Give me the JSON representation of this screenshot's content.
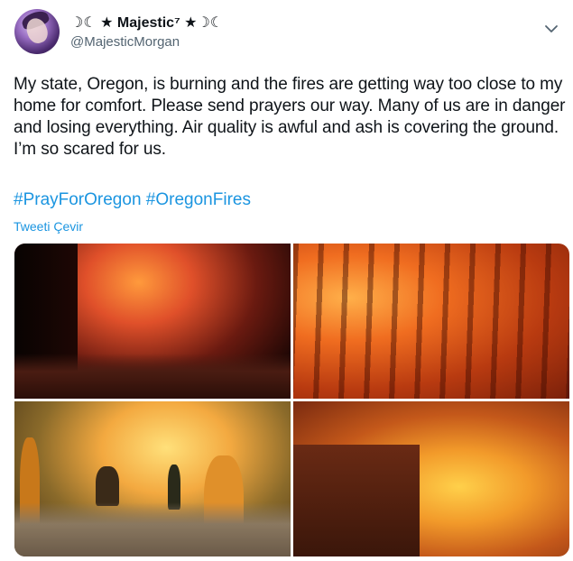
{
  "author": {
    "display_name": "☽☾ ★ Majestic⁷ ★☽☾",
    "handle": "@MajesticMorgan"
  },
  "tweet": {
    "text": "My state, Oregon, is burning and the fires are getting way too close to my home for comfort. Please send prayers our way. Many of us are in danger and losing everything. Air quality is awful and ash is covering the ground. I’m so scared for us.",
    "hashtags": [
      "#PrayForOregon",
      "#OregonFires"
    ],
    "translate_label": "Tweeti Çevir"
  },
  "icons": {
    "menu": "chevron-down-icon"
  },
  "colors": {
    "link": "#1b95e0",
    "text": "#0f1419",
    "secondary": "#536471"
  }
}
